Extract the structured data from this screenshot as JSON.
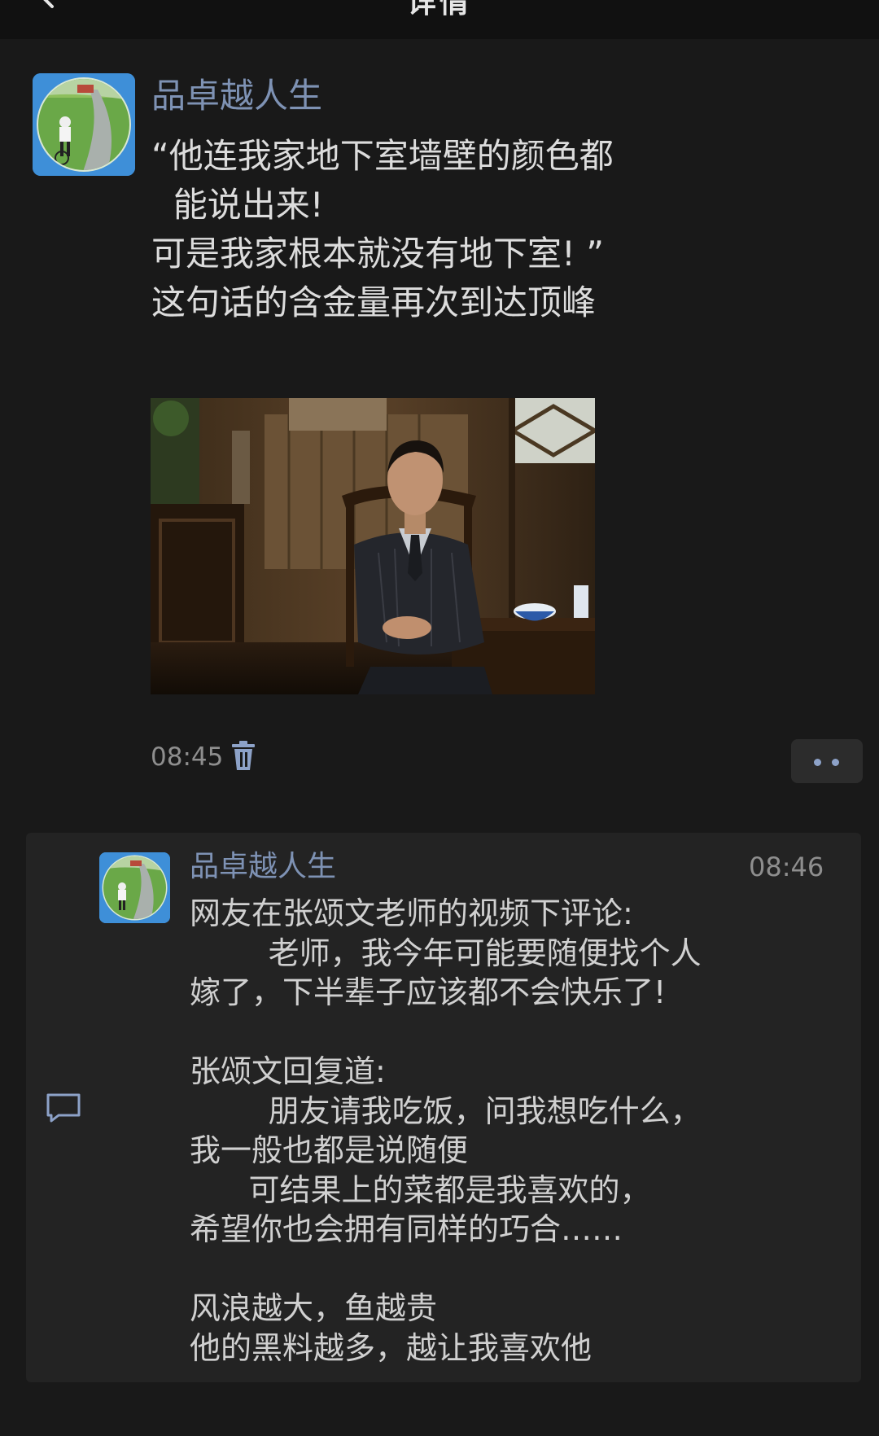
{
  "header": {
    "title": "详情"
  },
  "post": {
    "author": "品卓越人生",
    "text_lines": [
      "“他连我家地下室墙壁的颜色都",
      "  能说出来!",
      "可是我家根本就没有地下室! ”",
      "这句话的含金量再次到达顶峰"
    ],
    "time": "08:45"
  },
  "comment": {
    "author": "品卓越人生",
    "time": "08:46",
    "text_lines": [
      "网友在张颂文老师的视频下评论:",
      "        老师，我今年可能要随便找个人",
      "嫁了，下半辈子应该都不会快乐了!",
      "",
      "张颂文回复道:",
      "        朋友请我吃饭，问我想吃什么，",
      "我一般也都是说随便",
      "      可结果上的菜都是我喜欢的，",
      "希望你也会拥有同样的巧合……",
      "",
      "风浪越大，鱼越贵",
      "他的黑料越多，越让我喜欢他"
    ]
  },
  "icons": {
    "back": "chevron-left-icon",
    "delete": "trash-icon",
    "more": "more-dots-icon",
    "comment": "comment-bubble-icon"
  },
  "colors": {
    "background": "#191919",
    "author_name": "#7e92b4",
    "text": "#dcdcdc",
    "timestamp": "#8e8e8e",
    "comment_panel": "#232323"
  }
}
